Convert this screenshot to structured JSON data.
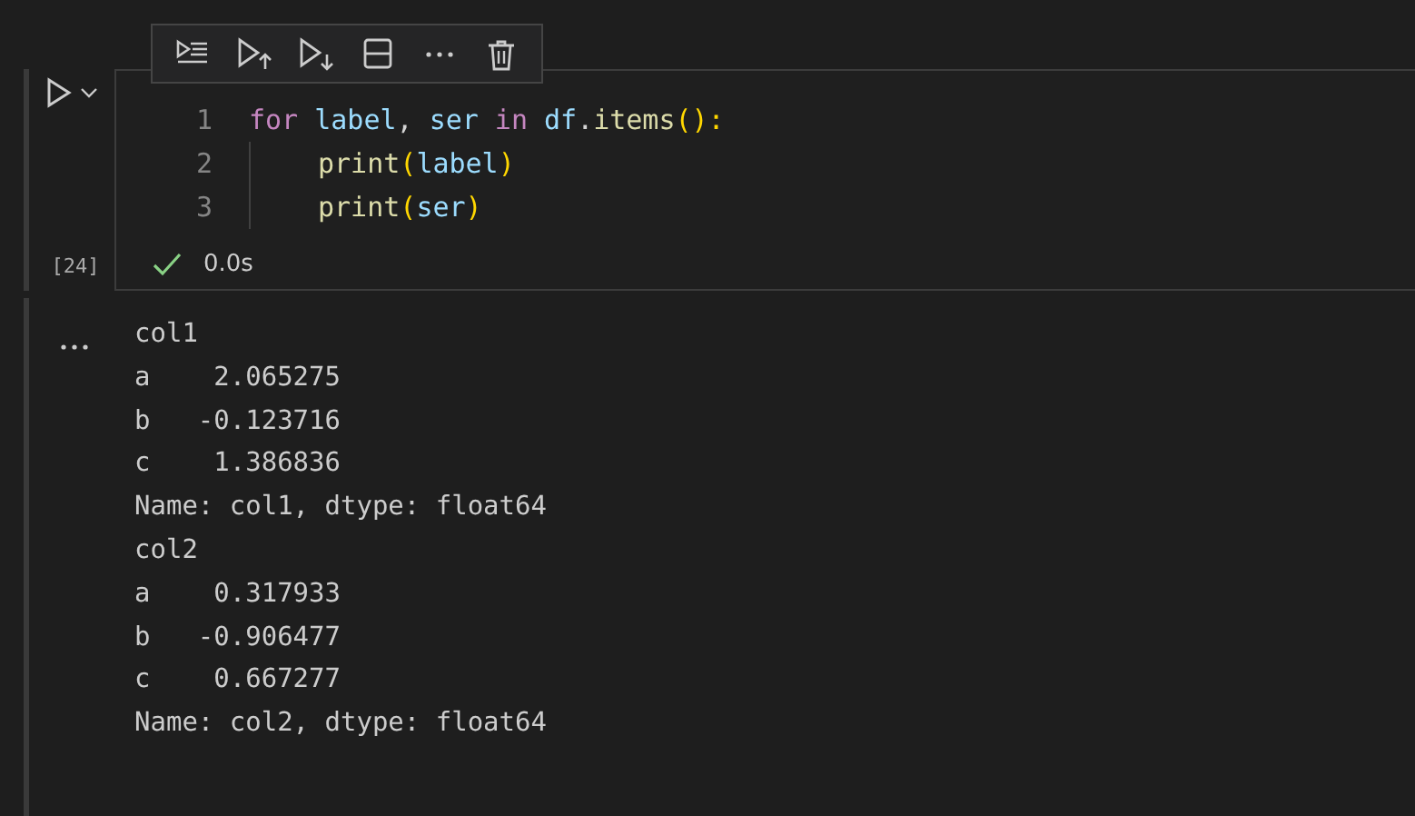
{
  "cell_toolbar": {
    "items": [
      {
        "kind": "run-by-line"
      },
      {
        "kind": "execute-above"
      },
      {
        "kind": "execute-below"
      },
      {
        "kind": "split"
      },
      {
        "kind": "more"
      },
      {
        "kind": "delete"
      }
    ]
  },
  "code_cell": {
    "execution_count": "[24]",
    "lines": [
      {
        "number": "1",
        "indented": false,
        "tokens": [
          {
            "text": "for",
            "kind": "keyword",
            "space_before": false
          },
          {
            "text": "label",
            "kind": "variable",
            "space_before": true
          },
          {
            "text": ",",
            "kind": "plain",
            "space_before": false
          },
          {
            "text": "ser",
            "kind": "variable",
            "space_before": true
          },
          {
            "text": "in",
            "kind": "keyword",
            "space_before": true
          },
          {
            "text": "df",
            "kind": "variable",
            "space_before": true
          },
          {
            "text": ".",
            "kind": "plain",
            "space_before": false
          },
          {
            "text": "items",
            "kind": "function",
            "space_before": false
          },
          {
            "text": "():",
            "kind": "bracket",
            "space_before": false
          }
        ]
      },
      {
        "number": "2",
        "indented": true,
        "tokens": [
          {
            "text": "print",
            "kind": "function",
            "space_before": false
          },
          {
            "text": "(",
            "kind": "bracket",
            "space_before": false
          },
          {
            "text": "label",
            "kind": "variable",
            "space_before": false
          },
          {
            "text": ")",
            "kind": "bracket",
            "space_before": false
          }
        ]
      },
      {
        "number": "3",
        "indented": true,
        "tokens": [
          {
            "text": "print",
            "kind": "function",
            "space_before": false
          },
          {
            "text": "(",
            "kind": "bracket",
            "space_before": false
          },
          {
            "text": "ser",
            "kind": "variable",
            "space_before": false
          },
          {
            "text": ")",
            "kind": "bracket",
            "space_before": false
          }
        ]
      }
    ],
    "status": {
      "success": true,
      "duration": "0.0s"
    }
  },
  "output": {
    "lines": [
      "col1",
      "a    2.065275",
      "b   -0.123716",
      "c    1.386836",
      "Name: col1, dtype: float64",
      "col2",
      "a    0.317933",
      "b   -0.906477",
      "c    0.667277",
      "Name: col2, dtype: float64"
    ]
  }
}
